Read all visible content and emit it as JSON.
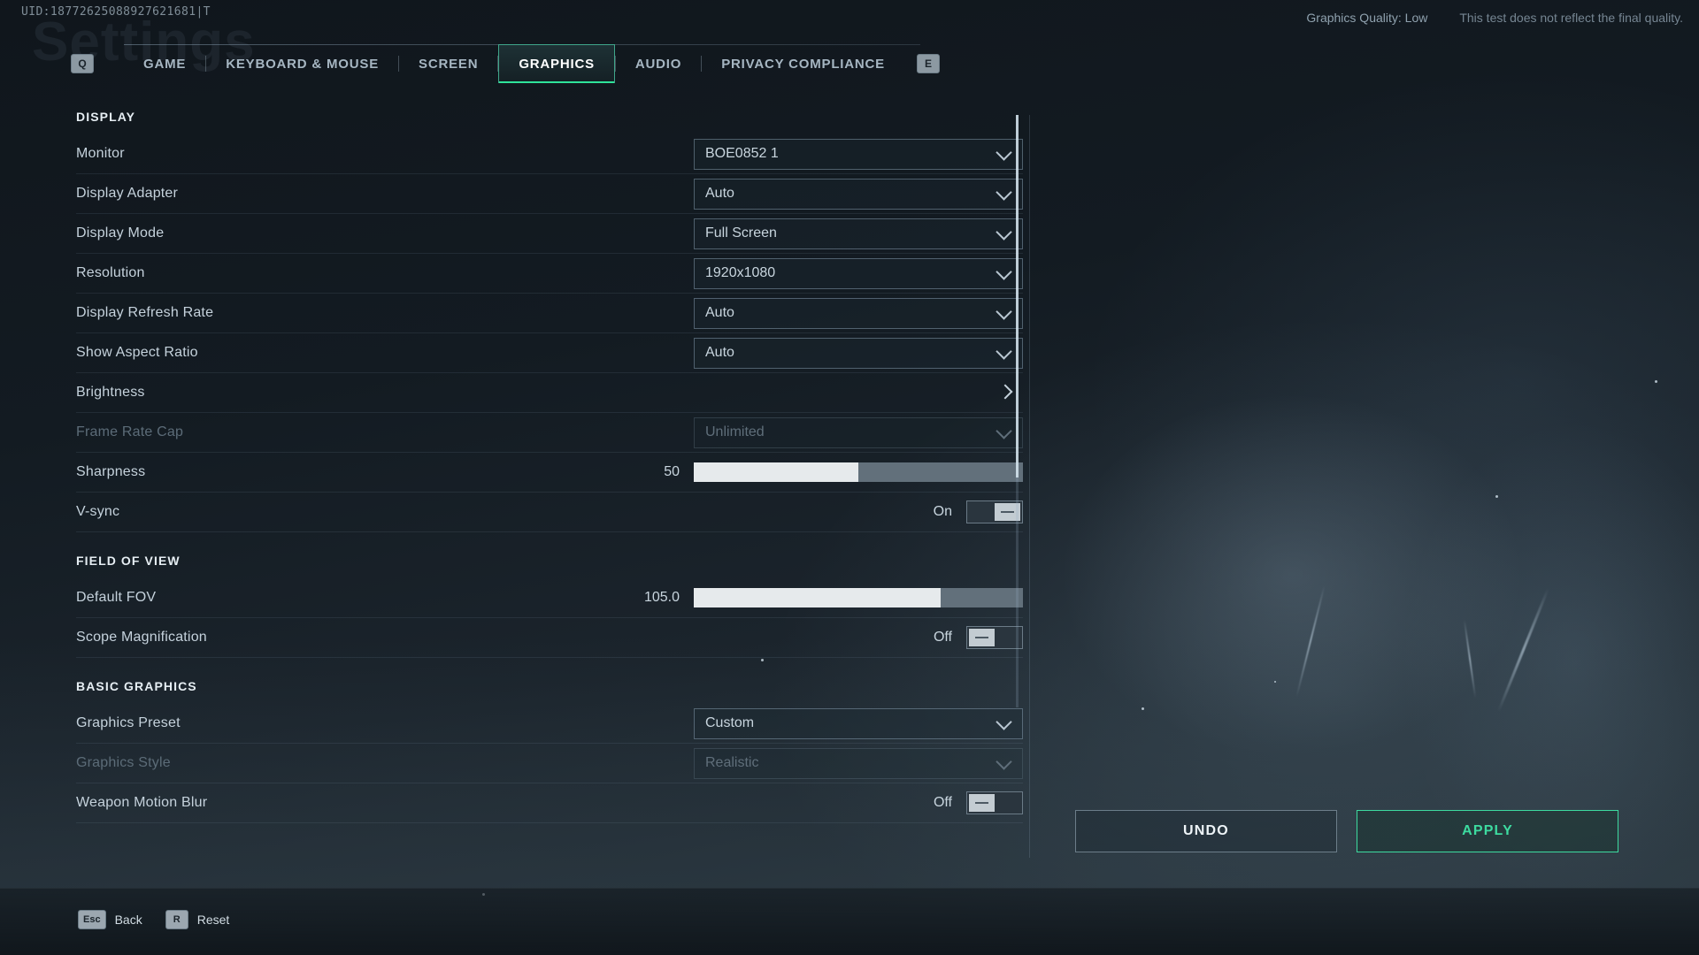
{
  "overlay": {
    "uid": "UID:18772625088927621681|T",
    "ghost_title": "Settings",
    "graphics_quality": "Graphics Quality: Low",
    "disclaimer": "This test does not reflect the final quality."
  },
  "tabbar": {
    "key_left": "Q",
    "key_right": "E",
    "tabs": [
      {
        "label": "GAME",
        "active": false
      },
      {
        "label": "KEYBOARD & MOUSE",
        "active": false
      },
      {
        "label": "SCREEN",
        "active": false
      },
      {
        "label": "GRAPHICS",
        "active": true
      },
      {
        "label": "AUDIO",
        "active": false
      },
      {
        "label": "PRIVACY COMPLIANCE",
        "active": false
      }
    ]
  },
  "sections": [
    {
      "title": "DISPLAY",
      "rows": [
        {
          "label": "Monitor",
          "type": "dropdown",
          "value": "BOE0852 1",
          "disabled": false
        },
        {
          "label": "Display Adapter",
          "type": "dropdown",
          "value": "Auto",
          "disabled": false
        },
        {
          "label": "Display Mode",
          "type": "dropdown",
          "value": "Full Screen",
          "disabled": false
        },
        {
          "label": "Resolution",
          "type": "dropdown",
          "value": "1920x1080",
          "disabled": false
        },
        {
          "label": "Display Refresh Rate",
          "type": "dropdown",
          "value": "Auto",
          "disabled": false
        },
        {
          "label": "Show Aspect Ratio",
          "type": "dropdown",
          "value": "Auto",
          "disabled": false
        },
        {
          "label": "Brightness",
          "type": "arrow",
          "value": "",
          "disabled": false
        },
        {
          "label": "Frame Rate Cap",
          "type": "dropdown",
          "value": "Unlimited",
          "disabled": true
        },
        {
          "label": "Sharpness",
          "type": "slider",
          "value": "50",
          "percent": 50,
          "disabled": false
        },
        {
          "label": "V-sync",
          "type": "toggle",
          "value": "On",
          "on": true,
          "disabled": false
        }
      ]
    },
    {
      "title": "FIELD OF VIEW",
      "rows": [
        {
          "label": "Default FOV",
          "type": "slider",
          "value": "105.0",
          "percent": 75,
          "disabled": false
        },
        {
          "label": "Scope Magnification",
          "type": "toggle",
          "value": "Off",
          "on": false,
          "disabled": false
        }
      ]
    },
    {
      "title": "BASIC GRAPHICS",
      "rows": [
        {
          "label": "Graphics Preset",
          "type": "dropdown",
          "value": "Custom",
          "disabled": false
        },
        {
          "label": "Graphics Style",
          "type": "dropdown",
          "value": "Realistic",
          "disabled": true
        },
        {
          "label": "Weapon Motion Blur",
          "type": "toggle",
          "value": "Off",
          "on": false,
          "disabled": false
        }
      ]
    }
  ],
  "actions": {
    "undo": "UNDO",
    "apply": "APPLY"
  },
  "footer": {
    "keys": [
      {
        "kbd": "Esc",
        "label": "Back"
      },
      {
        "kbd": "R",
        "label": "Reset"
      }
    ]
  },
  "colors": {
    "accent": "#2fe39a",
    "apply_border": "#3ddba0",
    "text_primary": "#c8d5de",
    "text_disabled": "#5f6e7a"
  }
}
